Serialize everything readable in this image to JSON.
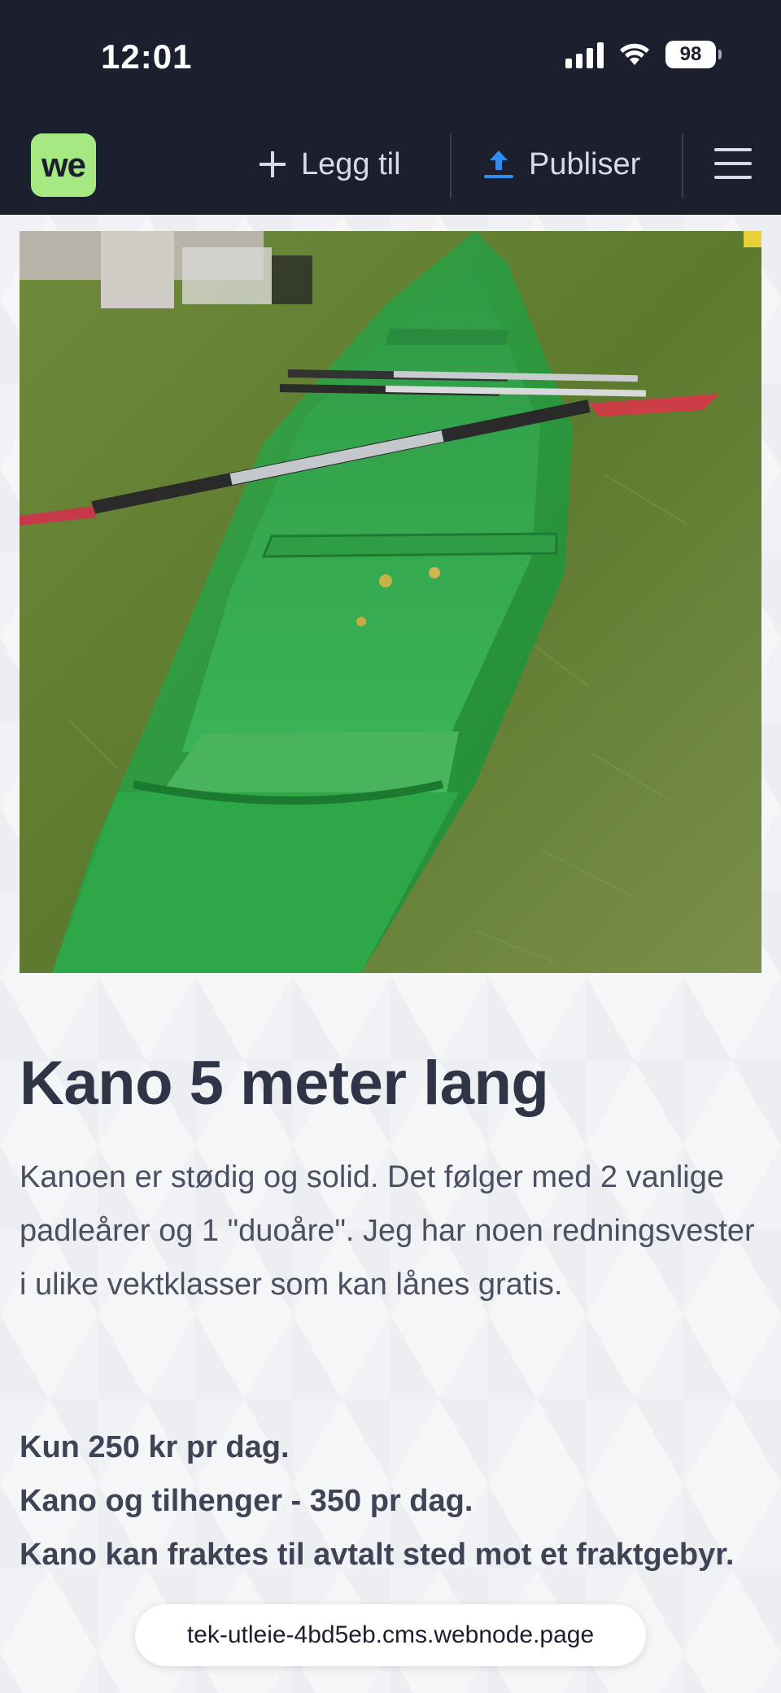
{
  "status_bar": {
    "time": "12:01",
    "battery": "98"
  },
  "toolbar": {
    "logo": "we",
    "add_label": "Legg til",
    "publish_label": "Publiser",
    "accent_color": "#2f8cf0",
    "logo_color": "#a6e882"
  },
  "product": {
    "image_alt": "green canoe with paddles on grass",
    "title": "Kano 5 meter lang",
    "description": "Kanoen er stødig og solid. Det følger med 2 vanlige padleårer og 1 \"duoåre\". Jeg har noen redningsvester i ulike vektklasser som kan lånes gratis.",
    "price_lines": [
      "Kun 250 kr pr dag.",
      "Kano og tilhenger - 350 pr dag.",
      "Kano kan fraktes til avtalt sted mot et fraktgebyr."
    ]
  },
  "browser": {
    "url": "tek-utleie-4bd5eb.cms.webnode.page"
  }
}
